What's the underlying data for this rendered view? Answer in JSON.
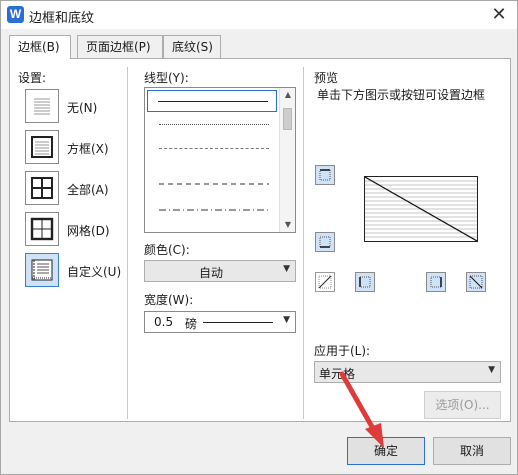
{
  "window": {
    "title": "边框和底纹",
    "close_glyph": "✕",
    "app_icon_letter": "W"
  },
  "tabs": [
    {
      "label": "边框(B)",
      "active": true
    },
    {
      "label": "页面边框(P)",
      "active": false
    },
    {
      "label": "底纹(S)",
      "active": false
    }
  ],
  "settings": {
    "label": "设置:",
    "items": [
      {
        "label": "无(N)",
        "icon": "none-border-icon"
      },
      {
        "label": "方框(X)",
        "icon": "box-border-icon"
      },
      {
        "label": "全部(A)",
        "icon": "all-borders-icon"
      },
      {
        "label": "网格(D)",
        "icon": "grid-border-icon"
      },
      {
        "label": "自定义(U)",
        "icon": "custom-border-icon",
        "selected": true
      }
    ]
  },
  "line_style": {
    "label": "线型(Y):"
  },
  "color": {
    "label": "颜色(C):",
    "value": "自动"
  },
  "width": {
    "label": "宽度(W):",
    "value": "0.5",
    "unit": "磅"
  },
  "preview": {
    "label": "预览",
    "hint": "单击下方图示或按钮可设置边框"
  },
  "apply_to": {
    "label": "应用于(L):",
    "value": "单元格"
  },
  "buttons": {
    "options": "选项(O)...",
    "ok": "确定",
    "cancel": "取消"
  },
  "colors": {
    "accent": "#2b6fd6",
    "selected_fill": "#cfe2f7",
    "annotation_arrow": "#e03b3b"
  }
}
